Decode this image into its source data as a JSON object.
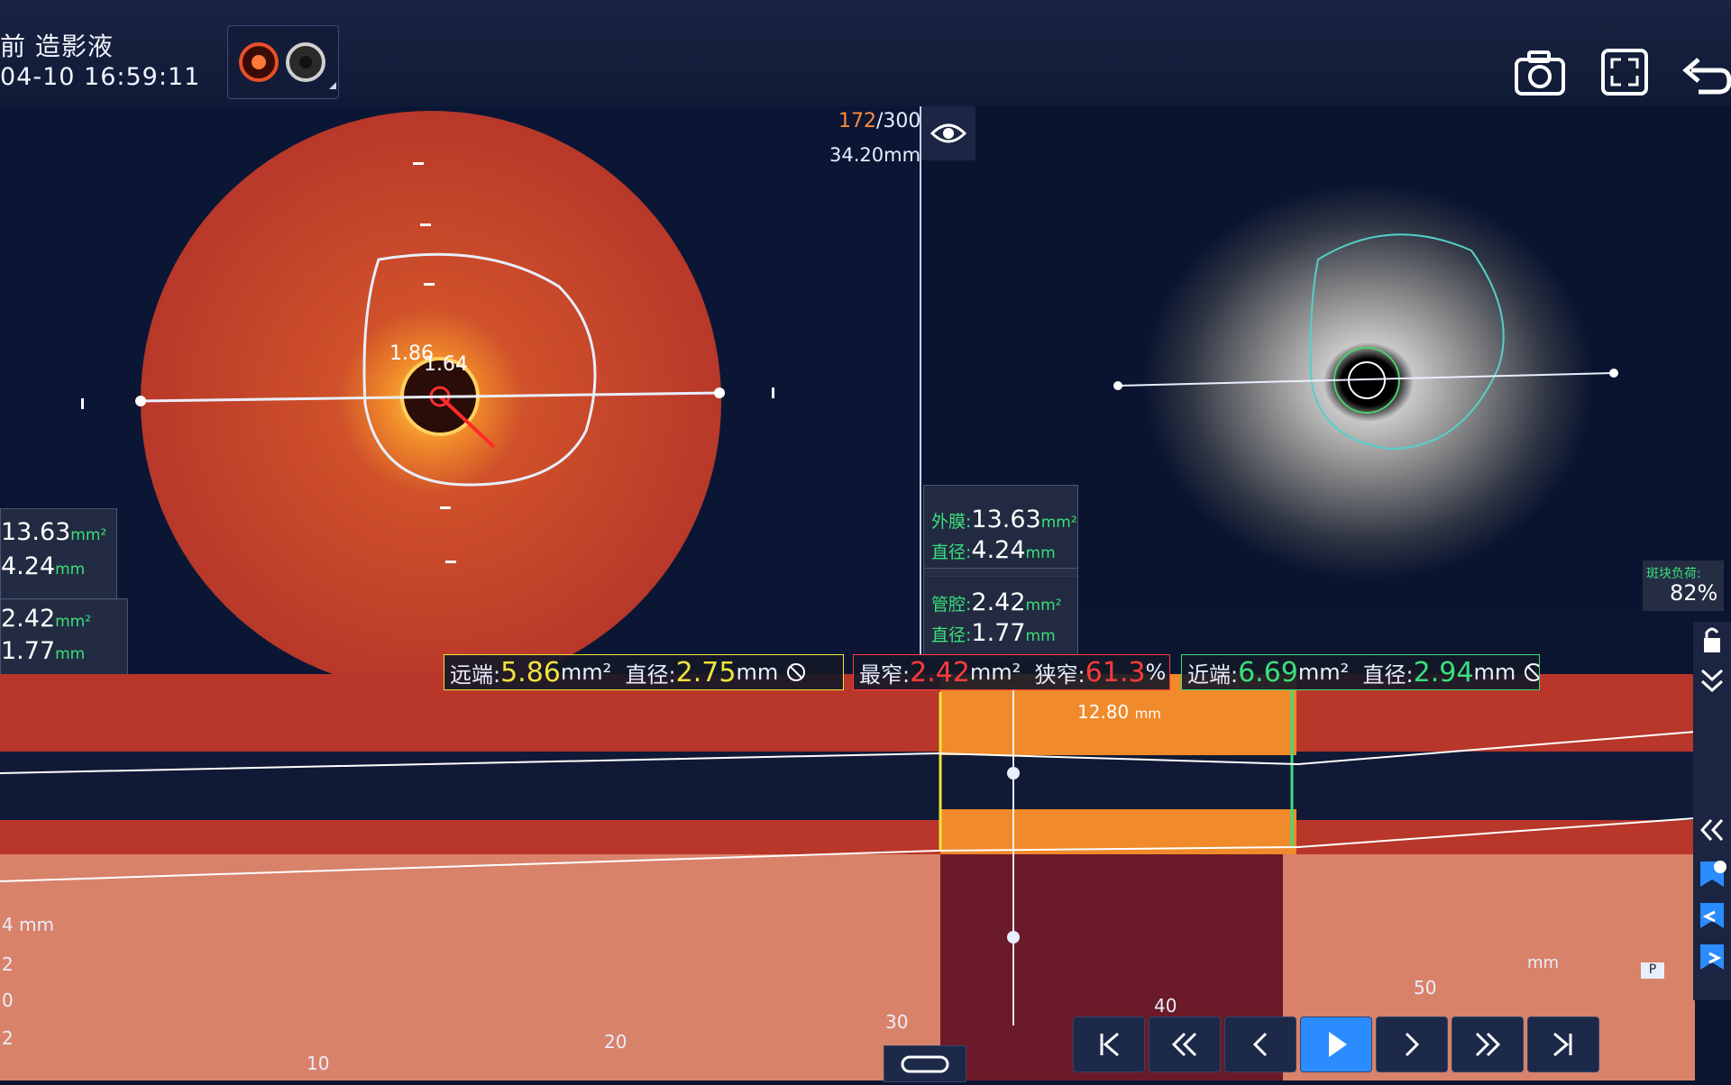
{
  "header": {
    "title": "前 造影液",
    "datetime": "04-10 16:59:11"
  },
  "toolbar": {
    "snapshot": "camera-icon",
    "fullscreen": "fullscreen-icon",
    "back": "undo-icon"
  },
  "oct": {
    "frame_current": "172",
    "frame_total": "/300",
    "depth": "34.20mm",
    "lumen_labels": [
      "1.86",
      "1.64"
    ],
    "meas1_area": "13.63",
    "meas1_area_unit": "mm²",
    "meas1_diam": "4.24",
    "meas1_diam_unit": "mm",
    "meas2_area": "2.42",
    "meas2_area_unit": "mm²",
    "meas2_diam": "1.77",
    "meas2_diam_unit": "mm"
  },
  "ivus": {
    "eem_label": "外膜:",
    "eem_area": "13.63",
    "eem_area_unit": "mm²",
    "eem_diam_label": "直径:",
    "eem_diam": "4.24",
    "eem_diam_unit": "mm",
    "lumen_label": "管腔:",
    "lumen_area": "2.42",
    "lumen_area_unit": "mm²",
    "lumen_diam_label": "直径:",
    "lumen_diam": "1.77",
    "lumen_diam_unit": "mm",
    "plaque_label": "斑块负荷:",
    "plaque_value": "82%"
  },
  "summary": {
    "distal_label": "远端:",
    "distal_area": "5.86",
    "distal_area_unit": "mm²",
    "distal_diam_label": "直径:",
    "distal_diam": "2.75",
    "distal_diam_unit": "mm",
    "min_label": "最窄:",
    "min_area": "2.42",
    "min_area_unit": "mm²",
    "stenosis_label": "狭窄:",
    "stenosis": "61.3",
    "stenosis_unit": "%",
    "proximal_label": "近端:",
    "proximal_area": "6.69",
    "proximal_area_unit": "mm²",
    "proximal_diam_label": "直径:",
    "proximal_diam": "2.94",
    "proximal_diam_unit": "mm",
    "segment_length": "12.80",
    "segment_length_unit": "mm"
  },
  "long_axis": {
    "y_labels": [
      "4 mm",
      "2",
      "0",
      "2"
    ],
    "x_ticks": [
      "10",
      "20",
      "30",
      "40",
      "50"
    ],
    "x_unit": "mm",
    "p_badge": "P"
  },
  "colors": {
    "yellow": "#f2e23a",
    "red": "#ff3b3b",
    "green": "#39e07a",
    "oct_orange": "#c2412a"
  }
}
